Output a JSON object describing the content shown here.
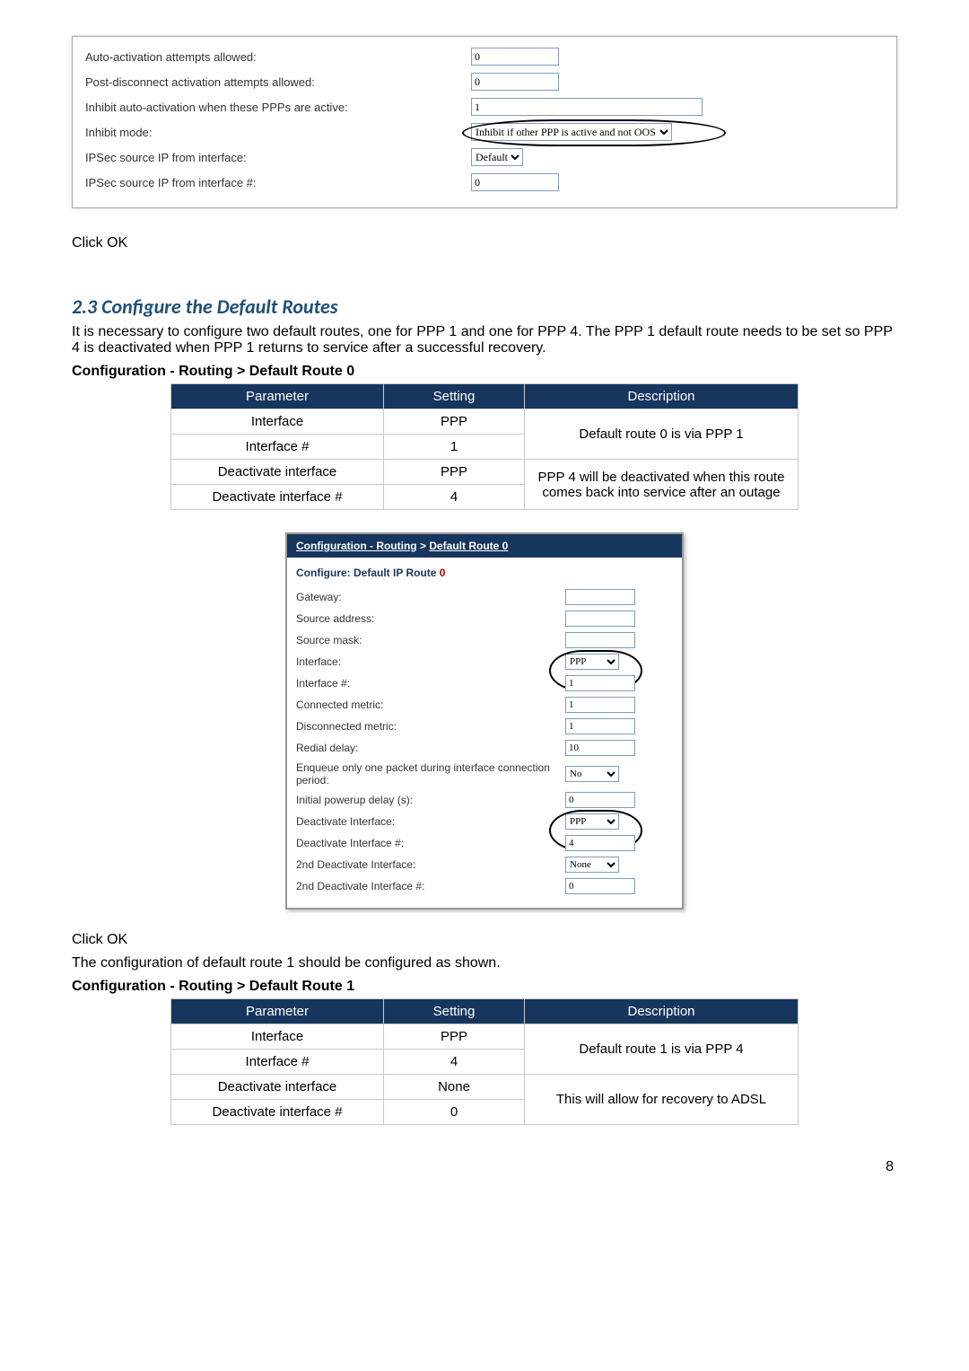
{
  "panel1": {
    "rows": [
      {
        "label": "Auto-activation attempts allowed:",
        "value": "0",
        "type": "text"
      },
      {
        "label": "Post-disconnect activation attempts allowed:",
        "value": "0",
        "type": "text"
      },
      {
        "label": "Inhibit auto-activation when these PPPs are active:",
        "value": "1",
        "type": "text",
        "wide": true
      },
      {
        "label": "Inhibit mode:",
        "value": "Inhibit if other PPP is active and not OOS",
        "type": "select",
        "oval": true
      },
      {
        "label": "IPSec source IP from interface:",
        "value": "Default",
        "type": "select"
      },
      {
        "label": "IPSec source IP from interface #:",
        "value": "0",
        "type": "text"
      }
    ]
  },
  "click_ok": "Click OK",
  "section_title": "2.3   Configure the Default Routes",
  "section_intro": "It is necessary to configure two default routes, one for PPP 1 and one for PPP 4. The PPP 1 default route needs to be set so PPP 4 is deactivated when PPP 1 returns to service after a successful recovery.",
  "path0": "Configuration - Routing > Default Route 0",
  "table0": {
    "headers": [
      "Parameter",
      "Setting",
      "Description"
    ],
    "rows": [
      {
        "param": "Interface",
        "setting": "PPP",
        "desc": "Default route 0 is via PPP 1",
        "desc_rowspan": 2
      },
      {
        "param": "Interface #",
        "setting": "1"
      },
      {
        "param": "Deactivate interface",
        "setting": "PPP",
        "desc": "PPP 4 will be deactivated when this route comes back into service after an outage",
        "desc_rowspan": 2
      },
      {
        "param": "Deactivate interface #",
        "setting": "4"
      }
    ]
  },
  "shot": {
    "crumb_a": "Configuration - Routing",
    "crumb_sep": " > ",
    "crumb_b": "Default Route 0",
    "subtitle_a": "Configure: Default IP Route ",
    "subtitle_b": "0",
    "fields": [
      {
        "label": "Gateway:",
        "type": "text",
        "value": ""
      },
      {
        "label": "Source address:",
        "type": "text",
        "value": ""
      },
      {
        "label": "Source mask:",
        "type": "text",
        "value": ""
      },
      {
        "label": "Interface:",
        "type": "select",
        "value": "PPP",
        "oval_top": true
      },
      {
        "label": "Interface #:",
        "type": "text",
        "value": "1",
        "oval_bottom": true
      },
      {
        "label": "Connected metric:",
        "type": "text",
        "value": "1"
      },
      {
        "label": "Disconnected metric:",
        "type": "text",
        "value": "1"
      },
      {
        "label": "Redial delay:",
        "type": "text",
        "value": "10"
      },
      {
        "label": "Enqueue only one packet during interface connection period:",
        "type": "select",
        "value": "No"
      },
      {
        "label": "Initial powerup delay (s):",
        "type": "text",
        "value": "0"
      },
      {
        "label": "Deactivate Interface:",
        "type": "select",
        "value": "PPP",
        "oval_top": true
      },
      {
        "label": "Deactivate Interface #:",
        "type": "text",
        "value": "4",
        "oval_bottom": true
      },
      {
        "label": "2nd Deactivate Interface:",
        "type": "select",
        "value": "None"
      },
      {
        "label": "2nd Deactivate Interface #:",
        "type": "text",
        "value": "0"
      }
    ]
  },
  "outro": "The configuration of default route 1 should be configured as shown.",
  "path1": "Configuration - Routing > Default Route 1",
  "table1": {
    "headers": [
      "Parameter",
      "Setting",
      "Description"
    ],
    "rows": [
      {
        "param": "Interface",
        "setting": "PPP",
        "desc": "Default route 1 is via PPP 4",
        "desc_rowspan": 2
      },
      {
        "param": "Interface #",
        "setting": "4"
      },
      {
        "param": "Deactivate interface",
        "setting": "None",
        "desc": "This will allow for recovery to ADSL",
        "desc_rowspan": 2
      },
      {
        "param": "Deactivate interface #",
        "setting": "0"
      }
    ]
  },
  "page_number": "8"
}
